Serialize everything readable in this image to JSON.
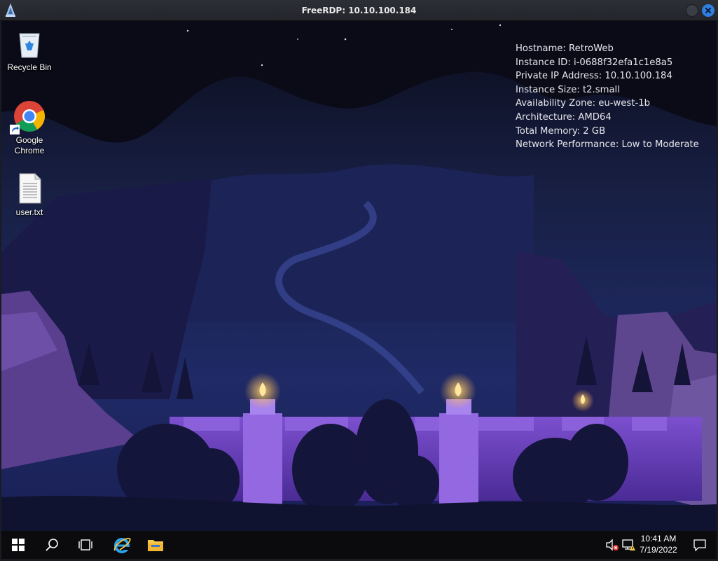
{
  "window": {
    "title": "FreeRDP: 10.10.100.184",
    "icon": "freerdp-icon"
  },
  "desktop": {
    "icons": [
      {
        "label": "Recycle Bin",
        "icon": "recycle-bin-icon"
      },
      {
        "label": "Google\nChrome",
        "icon": "chrome-icon"
      },
      {
        "label": "user.txt",
        "icon": "text-file-icon"
      }
    ],
    "sysinfo": [
      "Hostname: RetroWeb",
      "Instance ID: i-0688f32efa1c1e8a5",
      "Private IP Address: 10.10.100.184",
      "Instance Size: t2.small",
      "Availability Zone: eu-west-1b",
      "Architecture: AMD64",
      "Total Memory: 2 GB",
      "Network Performance: Low to Moderate"
    ]
  },
  "taskbar": {
    "pinned": [
      "start-windows-icon",
      "search-icon",
      "task-view-icon",
      "internet-explorer-icon",
      "file-explorer-icon"
    ],
    "tray": [
      "volume-muted-icon",
      "network-warning-icon"
    ],
    "time": "10:41 AM",
    "date": "7/19/2022",
    "notifications_icon": "action-center-icon"
  },
  "colors": {
    "accent": "#2f7fe0",
    "taskbar": "#0b0b0e",
    "wallpaper_sky": "#141a3c",
    "wallpaper_glow": "#7d4fd0"
  }
}
